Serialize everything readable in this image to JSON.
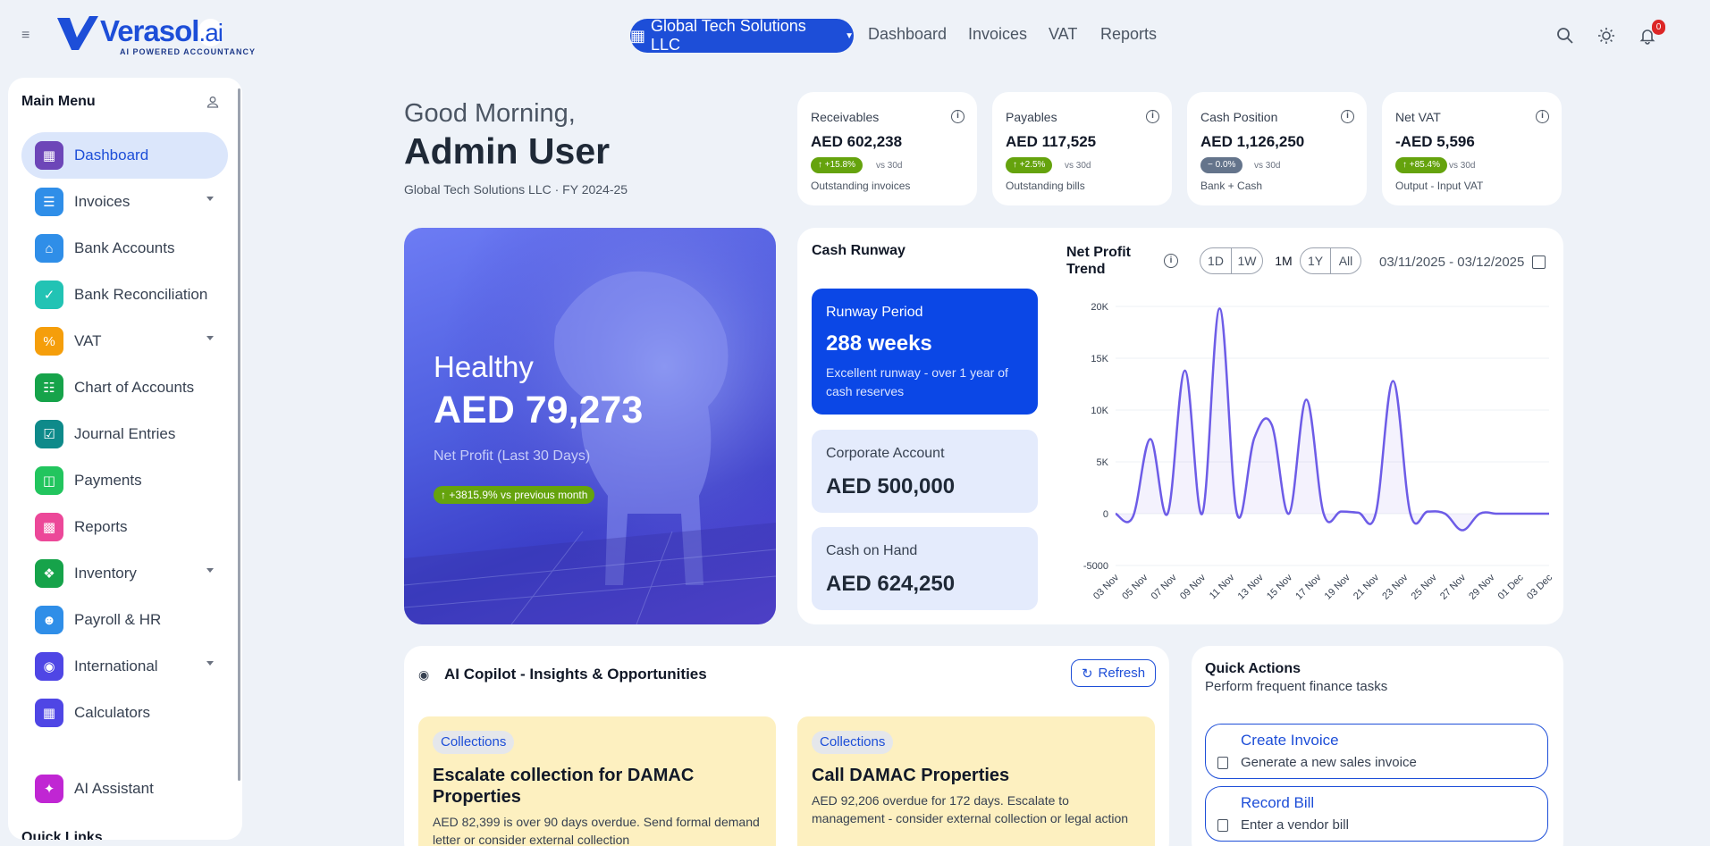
{
  "header": {
    "logo_main": "Verasol",
    "logo_suffix": ".ai",
    "logo_tagline": "AI POWERED ACCOUNTANCY",
    "company": "Global Tech Solutions LLC",
    "nav": [
      "Dashboard",
      "Invoices",
      "VAT",
      "Reports"
    ],
    "notification_count": "0",
    "icons": [
      "menu-icon",
      "search-icon",
      "sun-icon",
      "bell-icon"
    ]
  },
  "sidebar": {
    "title": "Main Menu",
    "items": [
      {
        "label": "Dashboard",
        "icon": "dashboard-icon",
        "color": "#6d46b8",
        "active": true
      },
      {
        "label": "Invoices",
        "icon": "invoice-icon",
        "color": "#2f8ee8",
        "caret": true
      },
      {
        "label": "Bank Accounts",
        "icon": "bank-icon",
        "color": "#2f8ee8"
      },
      {
        "label": "Bank Reconciliation",
        "icon": "check-circle-icon",
        "color": "#22c3b4"
      },
      {
        "label": "VAT",
        "icon": "percent-icon",
        "color": "#f59e0b",
        "caret": true
      },
      {
        "label": "Chart of Accounts",
        "icon": "ledger-icon",
        "color": "#16a34a"
      },
      {
        "label": "Journal Entries",
        "icon": "journal-icon",
        "color": "#0e8a8a"
      },
      {
        "label": "Payments",
        "icon": "wallet-icon",
        "color": "#22c55e"
      },
      {
        "label": "Reports",
        "icon": "bar-chart-icon",
        "color": "#ec4899"
      },
      {
        "label": "Inventory",
        "icon": "boxes-icon",
        "color": "#16a34a",
        "caret": true
      },
      {
        "label": "Payroll & HR",
        "icon": "users-icon",
        "color": "#2f8ee8"
      },
      {
        "label": "International",
        "icon": "globe-icon",
        "color": "#4f46e5",
        "caret": true
      },
      {
        "label": "Calculators",
        "icon": "calculator-icon",
        "color": "#4f46e5"
      },
      {
        "label": "AI Assistant",
        "icon": "sparkle-icon",
        "color": "#c026d3"
      }
    ],
    "quick_links": "Quick Links"
  },
  "greeting": {
    "line1": "Good Morning,",
    "line2": "Admin User",
    "sub": "Global Tech Solutions LLC · FY 2024-25"
  },
  "stats": [
    {
      "title": "Receivables",
      "value": "AED 602,238",
      "change": "↑ +15.8%",
      "vs": "vs 30d",
      "sub": "Outstanding invoices",
      "pill_color": "#65a30d"
    },
    {
      "title": "Payables",
      "value": "AED 117,525",
      "change": "↑ +2.5%",
      "vs": "vs 30d",
      "sub": "Outstanding bills",
      "pill_color": "#65a30d"
    },
    {
      "title": "Cash Position",
      "value": "AED 1,126,250",
      "change": "− 0.0%",
      "vs": "vs 30d",
      "sub": "Bank + Cash",
      "pill_color": "#64748b"
    },
    {
      "title": "Net VAT",
      "value": "-AED 5,596",
      "change": "↑ +85.4%",
      "vs": "vs 30d",
      "sub": "Output - Input VAT",
      "pill_color": "#65a30d"
    }
  ],
  "hero": {
    "status": "Healthy",
    "amount": "AED 79,273",
    "label": "Net Profit (Last 30 Days)",
    "change": "↑ +3815.9% vs previous month"
  },
  "runway": {
    "title": "Cash Runway",
    "period_label": "Runway Period",
    "period_value": "288 weeks",
    "period_desc": "Excellent runway - over 1 year of cash reserves",
    "corporate_label": "Corporate Account",
    "corporate_value": "AED 500,000",
    "cash_label": "Cash on Hand",
    "cash_value": "AED 624,250"
  },
  "trend": {
    "title": "Net Profit Trend",
    "ranges": [
      "1D",
      "1W",
      "1M",
      "1Y",
      "All"
    ],
    "selected_range": "1M",
    "date_range": "03/11/2025 - 03/12/2025"
  },
  "chart_data": {
    "type": "line",
    "title": "Net Profit Trend",
    "xlabel": "",
    "ylabel": "",
    "ylim": [
      -5000,
      20000
    ],
    "yticks": [
      "20K",
      "15K",
      "10K",
      "5K",
      "0",
      "-5000"
    ],
    "ytick_values": [
      20000,
      15000,
      10000,
      5000,
      0,
      -5000
    ],
    "xtick_labels": [
      "03 Nov",
      "05 Nov",
      "07 Nov",
      "09 Nov",
      "11 Nov",
      "13 Nov",
      "15 Nov",
      "17 Nov",
      "19 Nov",
      "21 Nov",
      "23 Nov",
      "25 Nov",
      "27 Nov",
      "29 Nov",
      "01 Dec",
      "03 Dec"
    ],
    "grid": true,
    "color": "#6d5ce7",
    "series": [
      {
        "values": [
          0,
          -300,
          7200,
          0,
          13800,
          0,
          19800,
          0,
          7300,
          8600,
          0,
          11000,
          0,
          200,
          100,
          0,
          12800,
          0,
          200,
          0,
          -1600,
          0,
          0,
          0,
          0,
          0
        ]
      }
    ]
  },
  "ai": {
    "title": "AI Copilot - Insights & Opportunities",
    "refresh": "Refresh",
    "cards": [
      {
        "tag": "Collections",
        "title": "Escalate collection for DAMAC Properties",
        "desc": "AED 82,399 is over 90 days overdue. Send formal demand letter or consider external collection"
      },
      {
        "tag": "Collections",
        "title": "Call DAMAC Properties",
        "desc": "AED 92,206 overdue for 172 days. Escalate to management - consider external collection or legal action"
      }
    ]
  },
  "quick_actions": {
    "title": "Quick Actions",
    "subtitle": "Perform frequent finance tasks",
    "items": [
      {
        "label": "Create Invoice",
        "desc": "Generate a new sales invoice"
      },
      {
        "label": "Record Bill",
        "desc": "Enter a vendor bill"
      }
    ]
  }
}
